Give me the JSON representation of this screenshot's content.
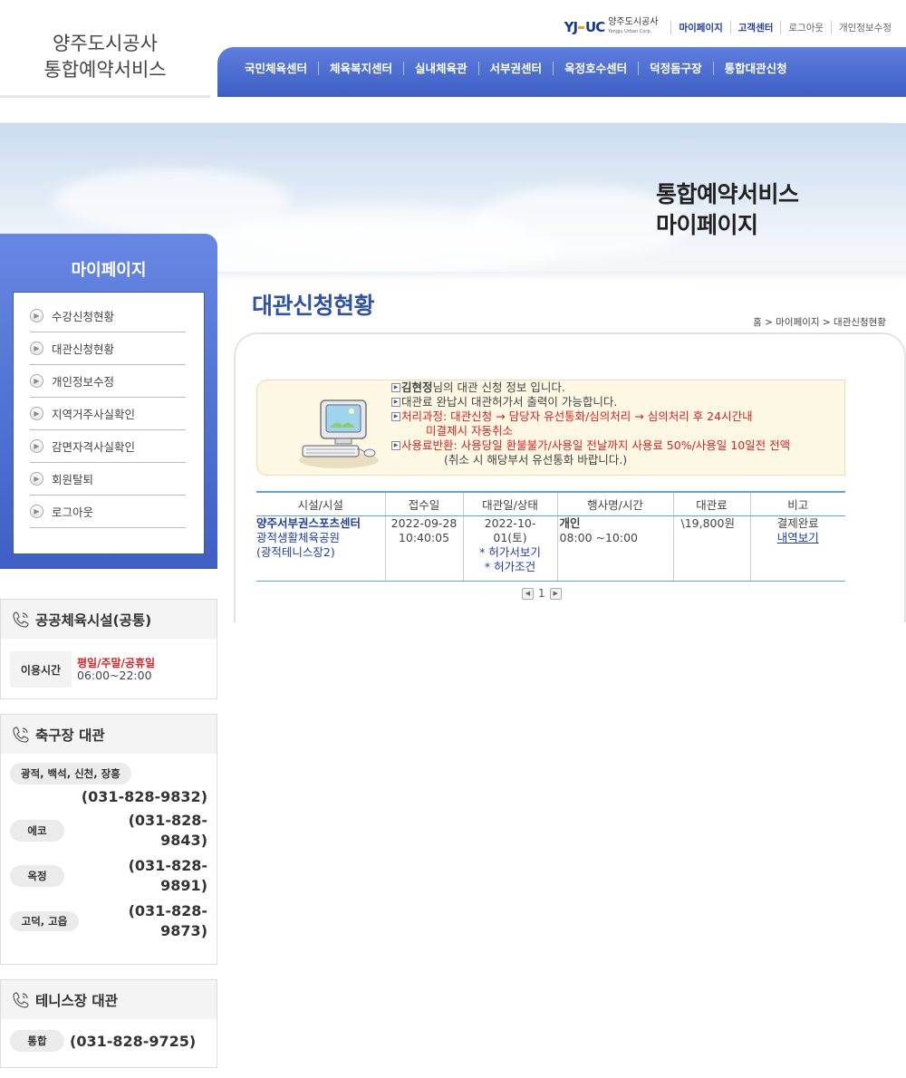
{
  "header": {
    "site_title_line1": "양주도시공사",
    "site_title_line2": "통합예약서비스",
    "logo_mark": "YJ UC",
    "logo_name": "양주도시공사",
    "logo_en": "Yangju Urban Corp.",
    "top_links": [
      "마이페이지",
      "고객센터",
      "로그아웃",
      "개인정보수정"
    ]
  },
  "gnb": [
    "국민체육센터",
    "체육복지센터",
    "실내체육관",
    "서부권센터",
    "옥정호수센터",
    "덕정돔구장",
    "통합대관신청"
  ],
  "banner": {
    "line1": "통합예약서비스",
    "line2": "마이페이지"
  },
  "sidebar": {
    "title": "마이페이지",
    "items": [
      "수강신청현황",
      "대관신청현황",
      "개인정보수정",
      "지역거주사실확인",
      "감면자격사실확인",
      "회원탈퇴",
      "로그아웃"
    ]
  },
  "info_public": {
    "title": "공공체육시설(공통)",
    "hours_label": "이용시간",
    "hours_days": "평일/주말/공휴일",
    "hours_time": "06:00~22:00"
  },
  "info_soccer": {
    "title": "축구장 대관",
    "rows": [
      {
        "area": "광적, 백석, 신천, 장흥",
        "phone": "(031-828-9832)"
      },
      {
        "area": "에코",
        "phone": "(031-828-9843)"
      },
      {
        "area": "옥정",
        "phone": "(031-828-9891)"
      },
      {
        "area": "고덕, 고읍",
        "phone": "(031-828-9873)"
      }
    ]
  },
  "info_tennis": {
    "title": "테니스장 대관",
    "rows": [
      {
        "area": "통합",
        "phone": "(031-828-9725)"
      }
    ]
  },
  "content": {
    "page_title": "대관신청현황",
    "breadcrumb": "홈 > 마이페이지 > 대관신청현황"
  },
  "notice": {
    "user_name": "김현정",
    "line1_suffix": "님의 대관 신청 정보 입니다.",
    "line2": "대관료 완납시 대관허가서 출력이 가능합니다.",
    "line3": "처리과정: 대관신청 → 담당자 유선통화/심의처리 → 심의처리 후 24시간내",
    "line3b": "미결제시 자동취소",
    "line4": "사용료반환: 사용당일 환불불가/사용일 전날까지 사용료 50%/사용일 10일전 전액",
    "line4b": "(취소 시 해당부서 유선통화 바랍니다.)"
  },
  "table": {
    "headers": [
      "시설/시설",
      "접수일",
      "대관일/상태",
      "행사명/시간",
      "대관료",
      "비고"
    ],
    "rows": [
      {
        "facility": "양주서부권스포츠센터",
        "facility_sub1": "광적생활체육공원",
        "facility_sub2": "(광적테니스장2)",
        "received_date": "2022-09-28",
        "received_time": "10:40:05",
        "rent_date1": "2022-10-",
        "rent_date2": "01(토)",
        "permit_view": "* 허가서보기",
        "permit_cond": "* 허가조건",
        "event_name": "개인",
        "event_time": "08:00 ~10:00",
        "fee": "\\19,800원",
        "status": "결제완료",
        "detail_link": "내역보기"
      }
    ]
  },
  "pager": {
    "current": "1"
  }
}
